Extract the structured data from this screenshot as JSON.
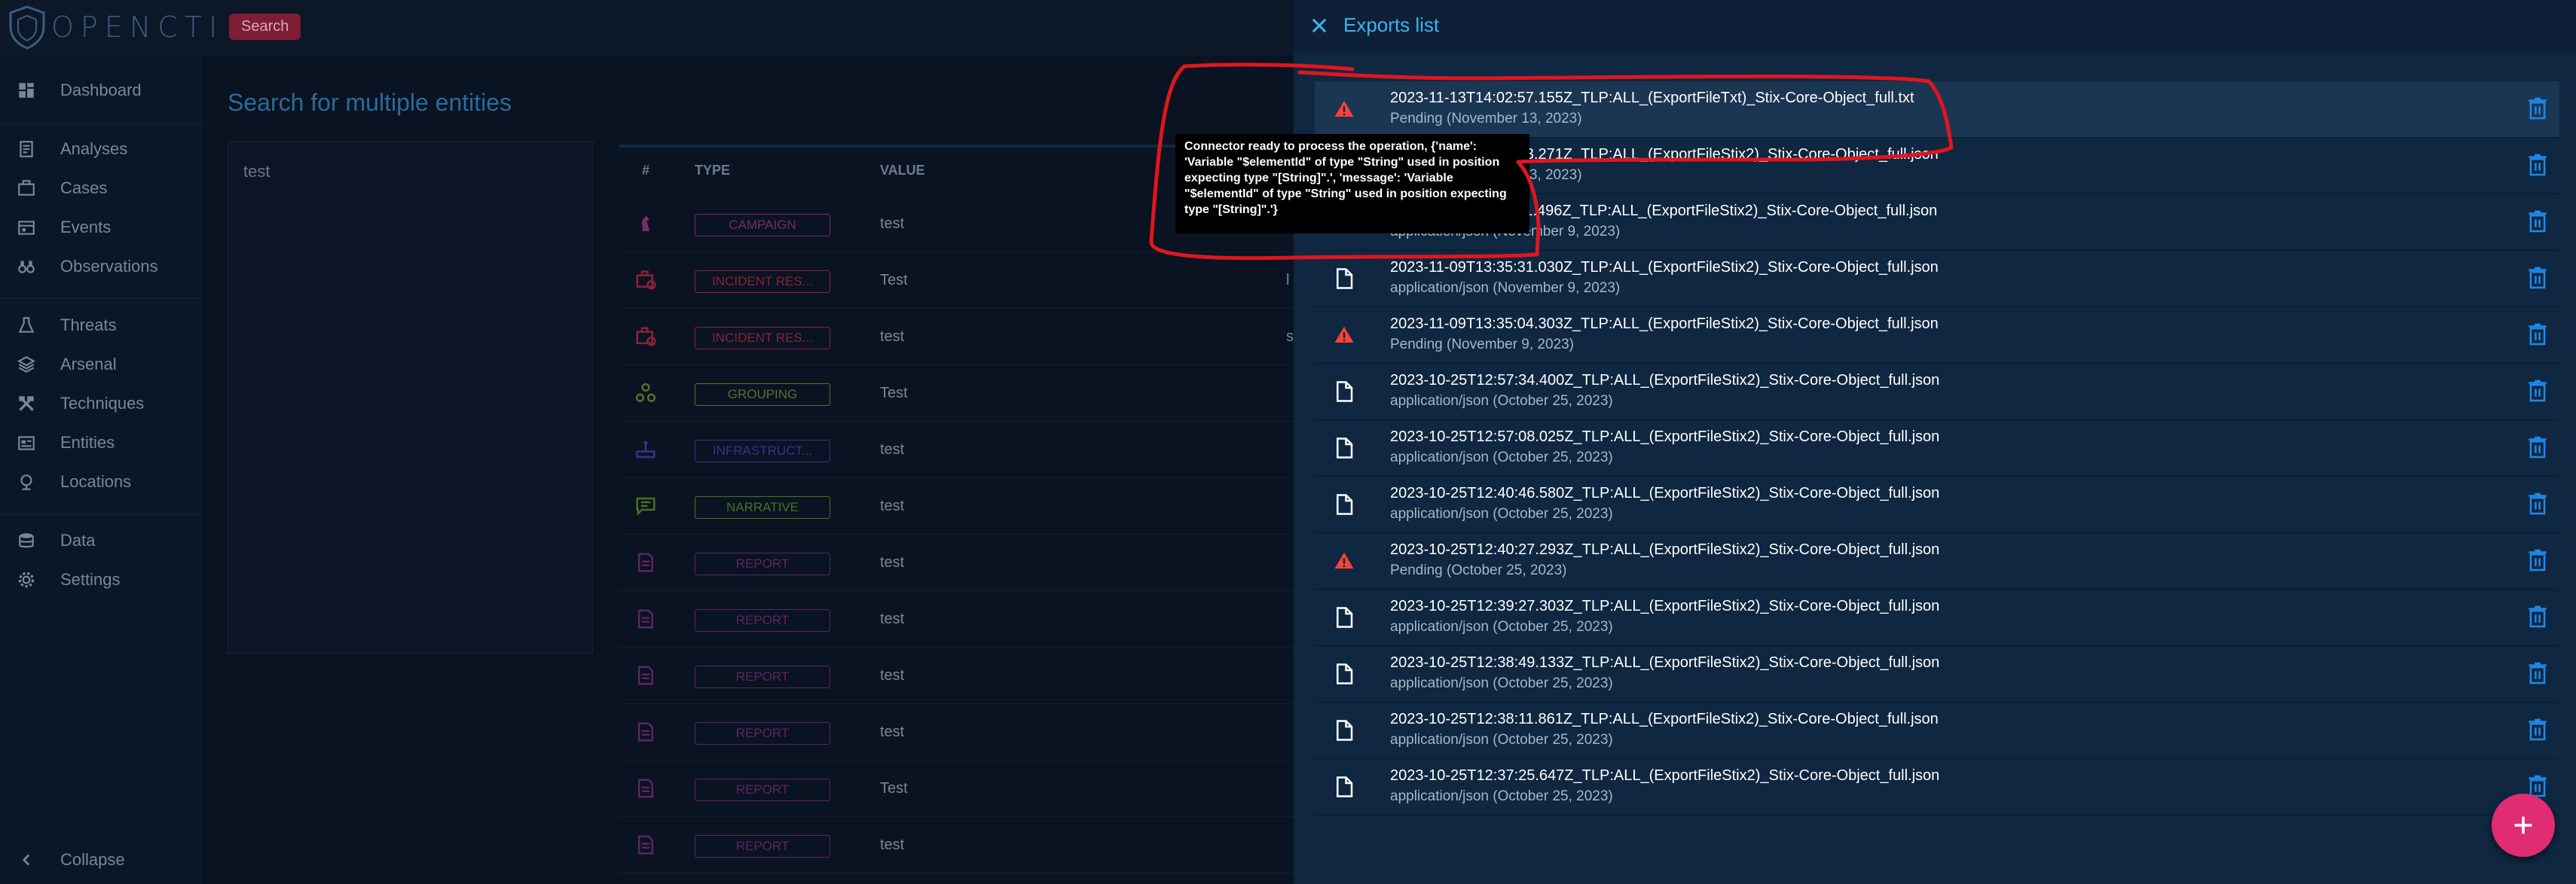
{
  "app": {
    "logo_text": "OPENCTI",
    "search_button": "Search",
    "page_title": "Search for multiple entities",
    "search_query": "test"
  },
  "sidebar": {
    "items": [
      {
        "label": "Dashboard",
        "icon": "dashboard-icon"
      },
      {
        "label": "Analyses",
        "icon": "analyses-icon"
      },
      {
        "label": "Cases",
        "icon": "cases-icon"
      },
      {
        "label": "Events",
        "icon": "events-icon"
      },
      {
        "label": "Observations",
        "icon": "observations-icon"
      },
      {
        "label": "Threats",
        "icon": "threats-icon"
      },
      {
        "label": "Arsenal",
        "icon": "arsenal-icon"
      },
      {
        "label": "Techniques",
        "icon": "techniques-icon"
      },
      {
        "label": "Entities",
        "icon": "entities-icon"
      },
      {
        "label": "Locations",
        "icon": "locations-icon"
      },
      {
        "label": "Data",
        "icon": "data-icon"
      },
      {
        "label": "Settings",
        "icon": "settings-icon"
      }
    ],
    "collapse_label": "Collapse"
  },
  "table": {
    "headers": {
      "num": "#",
      "type": "TYPE",
      "value": "VALUE"
    },
    "rows": [
      {
        "type": "CAMPAIGN",
        "value": "test",
        "extra": "",
        "color": "#7a2a6a",
        "icon": "campaign-icon"
      },
      {
        "type": "INCIDENT RES...",
        "value": "Test",
        "extra": "l",
        "color": "#8a2236",
        "icon": "incident-response-icon"
      },
      {
        "type": "INCIDENT RES...",
        "value": "test",
        "extra": "s",
        "color": "#8a2236",
        "icon": "incident-response-icon"
      },
      {
        "type": "GROUPING",
        "value": "Test",
        "extra": "",
        "color": "#5b6e2a",
        "icon": "grouping-icon"
      },
      {
        "type": "INFRASTRUCT...",
        "value": "test",
        "extra": "",
        "color": "#3e2f8a",
        "icon": "infrastructure-icon"
      },
      {
        "type": "NARRATIVE",
        "value": "test",
        "extra": "",
        "color": "#4e6f1e",
        "icon": "narrative-icon"
      },
      {
        "type": "REPORT",
        "value": "test",
        "extra": "",
        "color": "#5e2463",
        "icon": "report-icon"
      },
      {
        "type": "REPORT",
        "value": "test",
        "extra": "",
        "color": "#5e2463",
        "icon": "report-icon"
      },
      {
        "type": "REPORT",
        "value": "test",
        "extra": "",
        "color": "#5e2463",
        "icon": "report-icon"
      },
      {
        "type": "REPORT",
        "value": "test",
        "extra": "",
        "color": "#5e2463",
        "icon": "report-icon"
      },
      {
        "type": "REPORT",
        "value": "Test",
        "extra": "",
        "color": "#5e2463",
        "icon": "report-icon"
      },
      {
        "type": "REPORT",
        "value": "test",
        "extra": "",
        "color": "#5e2463",
        "icon": "report-icon"
      }
    ]
  },
  "drawer": {
    "title": "Exports list",
    "items": [
      {
        "name": "2023-11-13T14:02:57.155Z_TLP:ALL_(ExportFileTxt)_Stix-Core-Object_full.txt",
        "sub": "Pending (November 13, 2023)",
        "status": "error"
      },
      {
        "name": "2023-11-13T14:02:33.271Z_TLP:ALL_(ExportFileStix2)_Stix-Core-Object_full.json",
        "sub": "Pending (November 13, 2023)",
        "status": "file"
      },
      {
        "name": "2023-11-09T13:37:11.496Z_TLP:ALL_(ExportFileStix2)_Stix-Core-Object_full.json",
        "sub": "application/json (November 9, 2023)",
        "status": "file"
      },
      {
        "name": "2023-11-09T13:35:31.030Z_TLP:ALL_(ExportFileStix2)_Stix-Core-Object_full.json",
        "sub": "application/json (November 9, 2023)",
        "status": "file"
      },
      {
        "name": "2023-11-09T13:35:04.303Z_TLP:ALL_(ExportFileStix2)_Stix-Core-Object_full.json",
        "sub": "Pending (November 9, 2023)",
        "status": "error"
      },
      {
        "name": "2023-10-25T12:57:34.400Z_TLP:ALL_(ExportFileStix2)_Stix-Core-Object_full.json",
        "sub": "application/json (October 25, 2023)",
        "status": "file"
      },
      {
        "name": "2023-10-25T12:57:08.025Z_TLP:ALL_(ExportFileStix2)_Stix-Core-Object_full.json",
        "sub": "application/json (October 25, 2023)",
        "status": "file"
      },
      {
        "name": "2023-10-25T12:40:46.580Z_TLP:ALL_(ExportFileStix2)_Stix-Core-Object_full.json",
        "sub": "application/json (October 25, 2023)",
        "status": "file"
      },
      {
        "name": "2023-10-25T12:40:27.293Z_TLP:ALL_(ExportFileStix2)_Stix-Core-Object_full.json",
        "sub": "Pending (October 25, 2023)",
        "status": "error"
      },
      {
        "name": "2023-10-25T12:39:27.303Z_TLP:ALL_(ExportFileStix2)_Stix-Core-Object_full.json",
        "sub": "application/json (October 25, 2023)",
        "status": "file"
      },
      {
        "name": "2023-10-25T12:38:49.133Z_TLP:ALL_(ExportFileStix2)_Stix-Core-Object_full.json",
        "sub": "application/json (October 25, 2023)",
        "status": "file"
      },
      {
        "name": "2023-10-25T12:38:11.861Z_TLP:ALL_(ExportFileStix2)_Stix-Core-Object_full.json",
        "sub": "application/json (October 25, 2023)",
        "status": "file"
      },
      {
        "name": "2023-10-25T12:37:25.647Z_TLP:ALL_(ExportFileStix2)_Stix-Core-Object_full.json",
        "sub": "application/json (October 25, 2023)",
        "status": "file"
      }
    ],
    "tooltip": "Connector ready to process the operation, {'name': 'Variable \"$elementId\" of type \"String\" used in position expecting type \"[String]\".', 'message': 'Variable \"$elementId\" of type \"String\" used in position expecting type \"[String]\".'}"
  },
  "colors": {
    "accent": "#3fb3ef",
    "error": "#f44336",
    "delete": "#1e88e5",
    "fab": "#e02c72",
    "annotation": "#e0161e"
  },
  "icons": {
    "close": "close-icon",
    "warning": "warning-icon",
    "file": "file-icon",
    "delete": "delete-icon",
    "fab": "add-icon",
    "collapse": "chevron-left-icon"
  }
}
